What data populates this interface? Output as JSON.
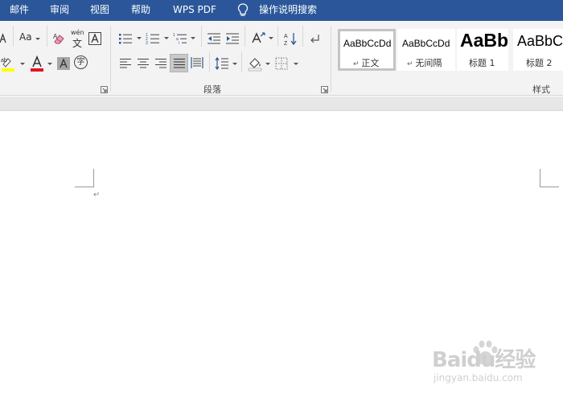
{
  "menu": {
    "tabs": [
      {
        "label": "邮件"
      },
      {
        "label": "审阅"
      },
      {
        "label": "视图"
      },
      {
        "label": "帮助"
      },
      {
        "label": "WPS PDF"
      }
    ],
    "tell_me": "操作说明搜索"
  },
  "ribbon": {
    "font": {
      "change_case_label": "Aa",
      "phonetic_top": "wén",
      "phonetic_bottom": "文",
      "enclose_char": "字",
      "highlight_color": "#ffff00",
      "font_color": "#e81123"
    },
    "paragraph": {
      "group_label": "段落"
    },
    "styles": {
      "group_label": "样式",
      "items": [
        {
          "sample": "AaBbCcDd",
          "name": "正文",
          "selected": true
        },
        {
          "sample": "AaBbCcDd",
          "name": "无间隔",
          "selected": false
        },
        {
          "sample": "AaBbC",
          "name": "标题 1",
          "selected": false
        },
        {
          "sample": "AaBbC",
          "name": "标题 2",
          "selected": false
        }
      ]
    }
  },
  "document": {
    "paragraph_mark": "↵"
  },
  "watermark": {
    "brand": "Baidu经验",
    "url": "jingyan.baidu.com"
  },
  "colors": {
    "title_bar": "#2b579a",
    "ribbon_bg": "#f3f3f3",
    "accent_icon": "#2b579a"
  }
}
